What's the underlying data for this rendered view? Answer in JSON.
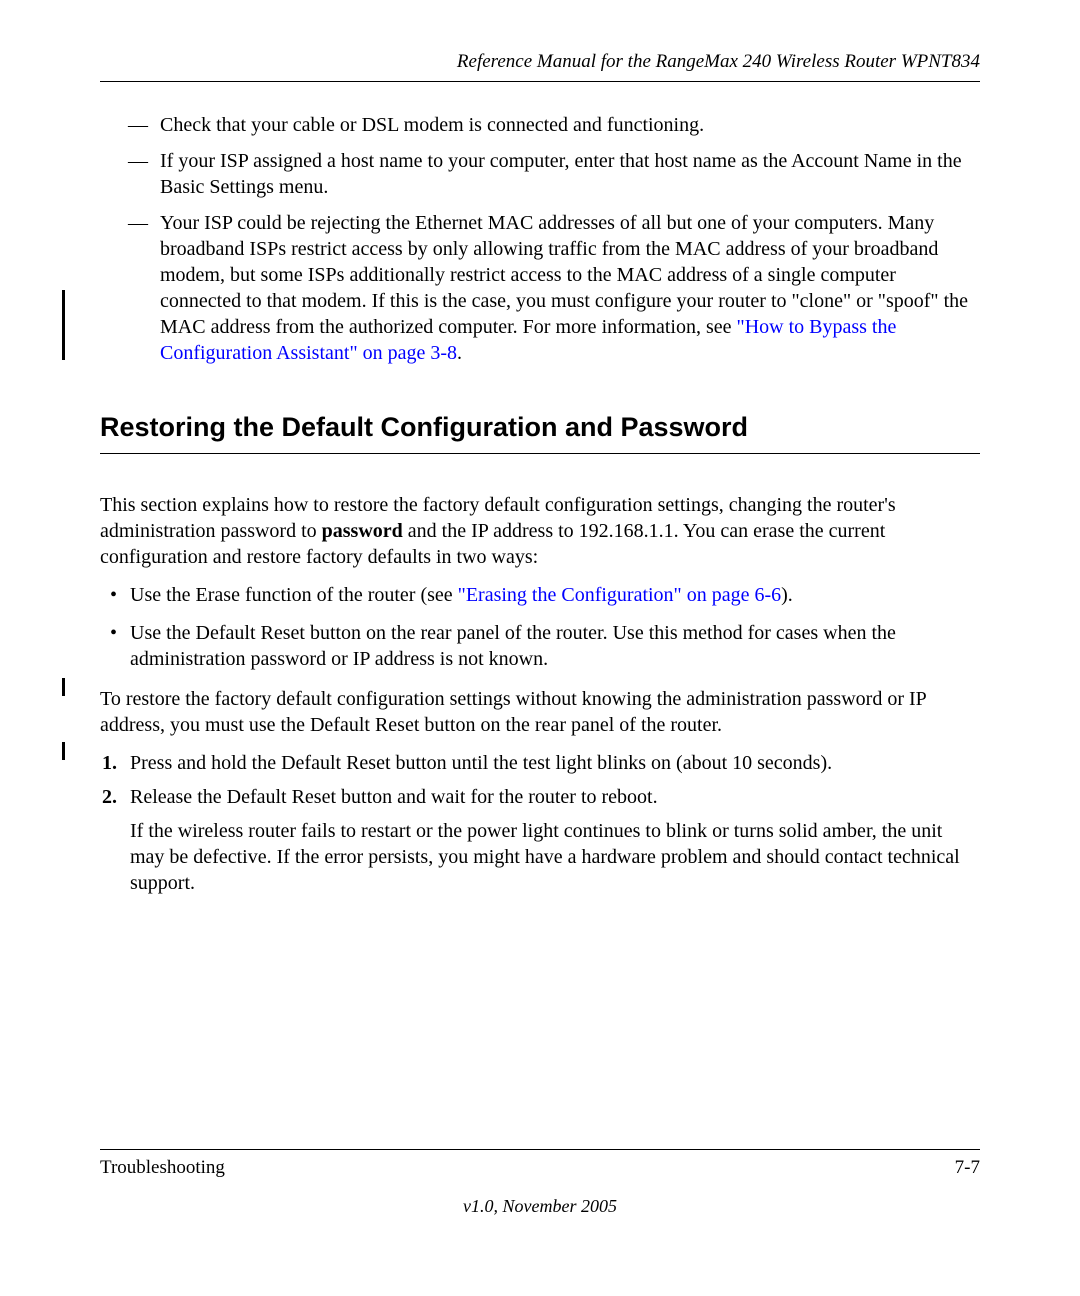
{
  "header": {
    "title": "Reference Manual for the RangeMax 240 Wireless Router WPNT834"
  },
  "dash_items": {
    "d1": "Check that your cable or DSL modem is connected and functioning.",
    "d2": "If your ISP assigned a host name to your computer, enter that host name as the Account Name in the Basic Settings menu.",
    "d3_before": "Your ISP could be rejecting the Ethernet MAC addresses of all but one of your computers. Many broadband ISPs restrict access by only allowing traffic from the MAC address of your broadband modem, but some ISPs additionally restrict access to the MAC address of a single computer connected to that modem. If this is the case, you must configure your router to \"clone\" or \"spoof\" the MAC address from the authorized computer. For more information, see ",
    "d3_link": "\"How to Bypass the Configuration Assistant\" on page 3-8",
    "d3_after": "."
  },
  "section": {
    "heading": "Restoring the Default Configuration and Password"
  },
  "intro": {
    "p1_before": "This section explains how to restore the factory default configuration settings, changing the router's administration password to ",
    "p1_bold": "password",
    "p1_after": " and the IP address to 192.168.1.1. You can erase the current configuration and restore factory defaults in two ways:"
  },
  "bullets": {
    "b1_before": "Use the Erase function of the router (see ",
    "b1_link": "\"Erasing the Configuration\" on page 6-6",
    "b1_after": ").",
    "b2": "Use the Default Reset button on the rear panel of the router. Use this method for cases when the administration password or IP address is not known."
  },
  "para2": "To restore the factory default configuration settings without knowing the administration password or IP address, you must use the Default Reset button on the rear panel of the router.",
  "steps": {
    "n1": "1.",
    "s1": "Press and hold the Default Reset button until the test light blinks on (about 10 seconds).",
    "n2": "2.",
    "s2": "Release the Default Reset button and wait for the router to reboot.",
    "s2b": "If the wireless router fails to restart or the power light continues to blink or turns solid amber, the unit may be defective. If the error persists, you might have a hardware problem and should contact technical support."
  },
  "footer": {
    "section_name": "Troubleshooting",
    "page_num": "7-7",
    "version": "v1.0, November 2005"
  }
}
